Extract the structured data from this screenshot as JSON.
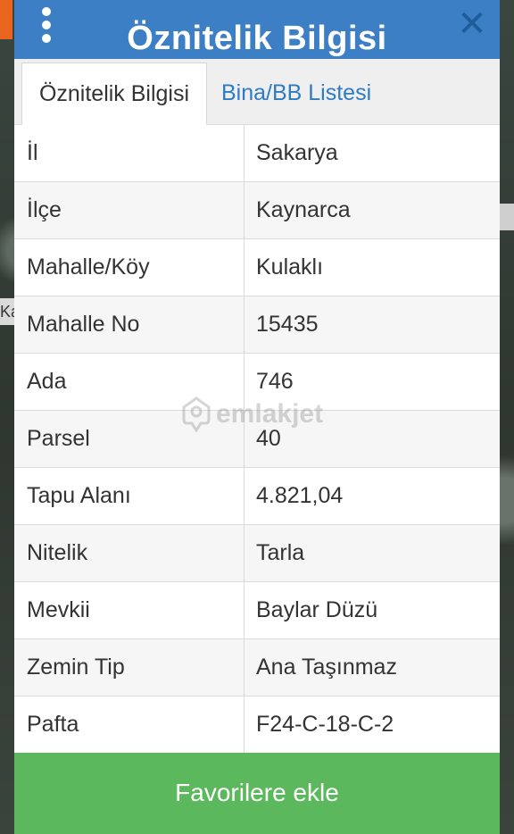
{
  "header": {
    "title": "Öznitelik Bilgisi",
    "menu_icon": "more-vertical-icon",
    "close_icon": "close-icon"
  },
  "tabs": [
    {
      "label": "Öznitelik Bilgisi",
      "active": true
    },
    {
      "label": "Bina/BB Listesi",
      "active": false
    }
  ],
  "rows": [
    {
      "key": "İl",
      "value": "Sakarya"
    },
    {
      "key": "İlçe",
      "value": "Kaynarca"
    },
    {
      "key": "Mahalle/Köy",
      "value": "Kulaklı"
    },
    {
      "key": "Mahalle No",
      "value": "15435"
    },
    {
      "key": "Ada",
      "value": "746"
    },
    {
      "key": "Parsel",
      "value": "40"
    },
    {
      "key": "Tapu Alanı",
      "value": "4.821,04"
    },
    {
      "key": "Nitelik",
      "value": "Tarla"
    },
    {
      "key": "Mevkii",
      "value": "Baylar Düzü"
    },
    {
      "key": "Zemin Tip",
      "value": "Ana Taşınmaz"
    },
    {
      "key": "Pafta",
      "value": "F24-C-18-C-2"
    }
  ],
  "watermark": "emlakjet",
  "favorite_button": "Favorilere ekle",
  "colors": {
    "header": "#3d7fc4",
    "tab_link": "#2f7bc2",
    "button": "#5cb85c"
  }
}
